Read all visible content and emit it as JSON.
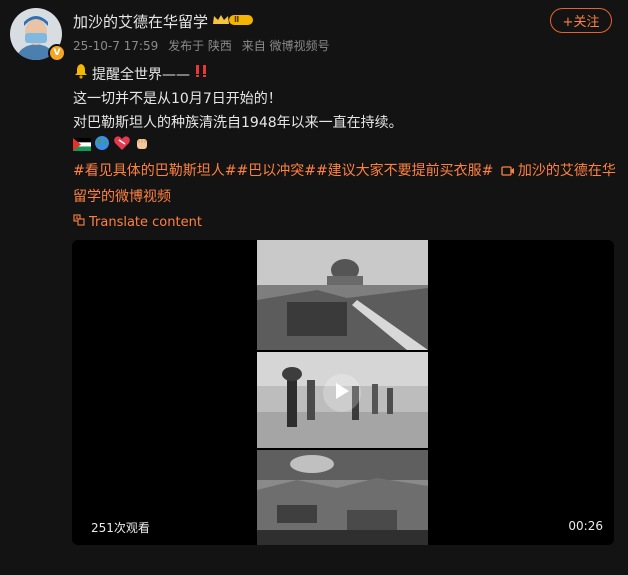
{
  "user": {
    "name": "加沙的艾德在华留学",
    "verified_mark": "V",
    "level": "Ⅱ"
  },
  "meta": {
    "datetime": "25-10-7 17:59",
    "location": "发布于 陕西",
    "source": "来自 微博视频号"
  },
  "follow_label": "+关注",
  "post": {
    "line1": "提醒全世界——",
    "line2": "这一切并不是从10月7日开始的！",
    "line3": "对巴勒斯坦人的种族清洗自1948年以来一直在持续。",
    "hashtag1": "#看见具体的巴勒斯坦人#",
    "hashtag2": "#巴以冲突#",
    "hashtag3": "#建议大家不要提前买衣服#",
    "video_link": "加沙的艾德在华留学的微博视频"
  },
  "translate_label": "Translate content",
  "video": {
    "views": "251次观看",
    "duration": "00:26"
  },
  "colors": {
    "accent": "#ff8140",
    "background": "#131313",
    "gold": "#f5a623"
  },
  "icons": [
    "bell-icon",
    "double-exclamation-icon",
    "palestine-flag-icon",
    "globe-icon",
    "heart-icon",
    "fist-icon",
    "translate-icon",
    "video-camera-icon",
    "play-icon"
  ]
}
